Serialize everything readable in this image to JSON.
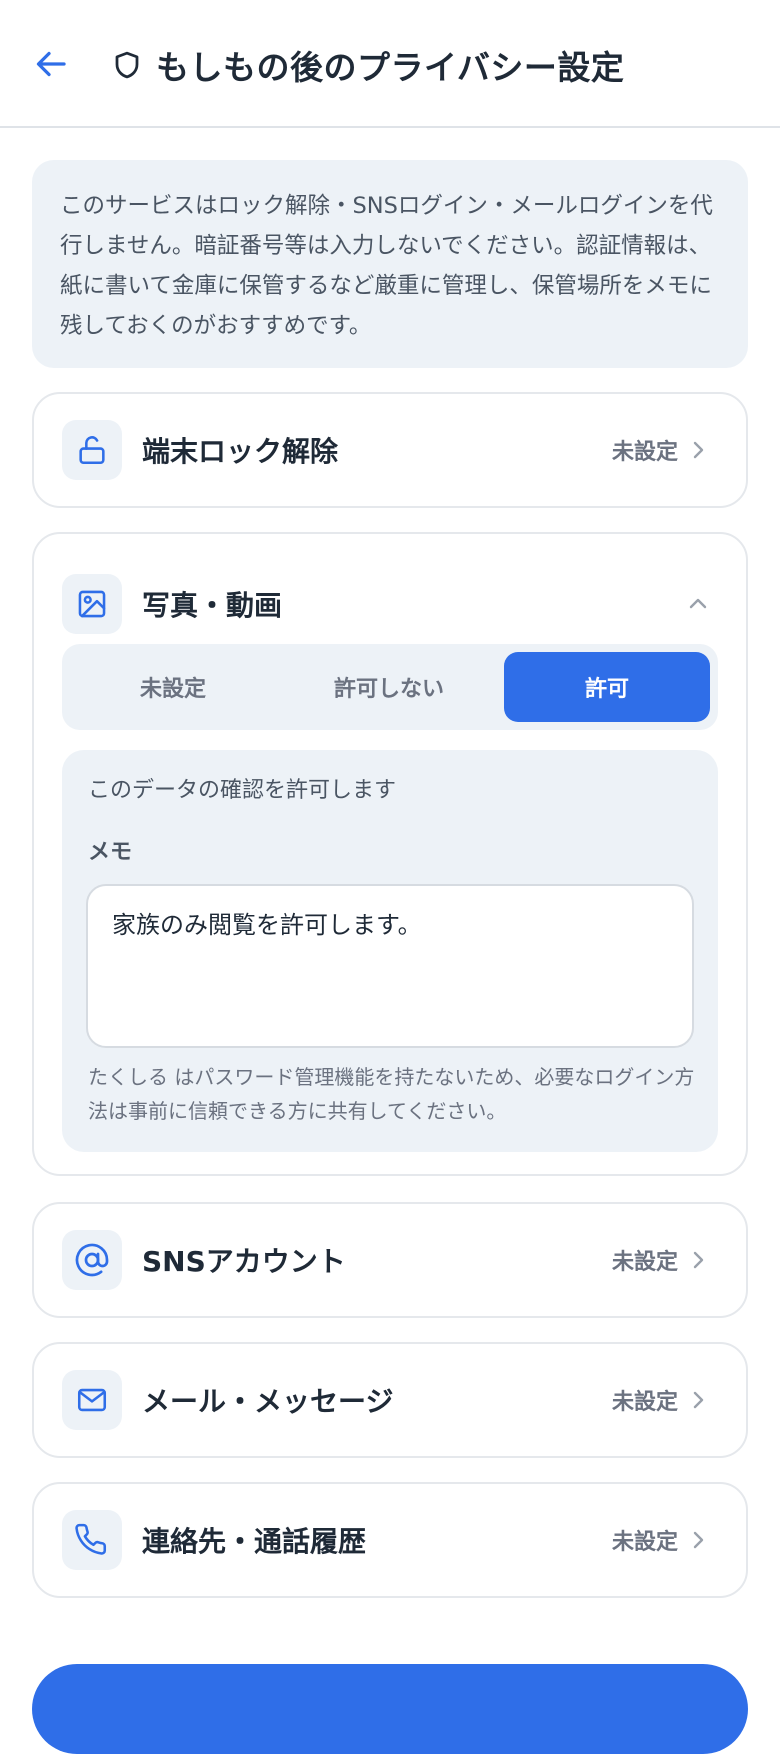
{
  "header": {
    "title": "もしもの後のプライバシー設定",
    "back_icon": "arrow-left-icon",
    "title_icon": "shield-icon",
    "accent_color": "#2f6ee8"
  },
  "notice": {
    "text": "このサービスはロック解除・SNSログイン・メールログインを代行しません。暗証番号等は入力しないでください。認証情報は、紙に書いて金庫に保管するなど厳重に管理し、保管場所をメモに残しておくのがおすすめです。"
  },
  "items": [
    {
      "label": "端末ロック解除",
      "status": "未設定",
      "icon": "unlock-icon",
      "expanded": false
    },
    {
      "label": "写真・動画",
      "status": "",
      "icon": "image-icon",
      "expanded": true
    },
    {
      "label": "SNSアカウント",
      "status": "未設定",
      "icon": "at-sign-icon",
      "expanded": false
    },
    {
      "label": "メール・メッセージ",
      "status": "未設定",
      "icon": "mail-icon",
      "expanded": false
    },
    {
      "label": "連絡先・通話履歴",
      "status": "未設定",
      "icon": "phone-icon",
      "expanded": false
    }
  ],
  "photo_settings": {
    "options": [
      "未設定",
      "許可しない",
      "許可"
    ],
    "selected": "許可",
    "description": "このデータの確認を許可します",
    "memo_label": "メモ",
    "memo_value": "家族のみ閲覧を許可します。",
    "note": "たくしる はパスワード管理機能を持たないため、必要なログイン方法は事前に信頼できる方に共有してください。"
  }
}
